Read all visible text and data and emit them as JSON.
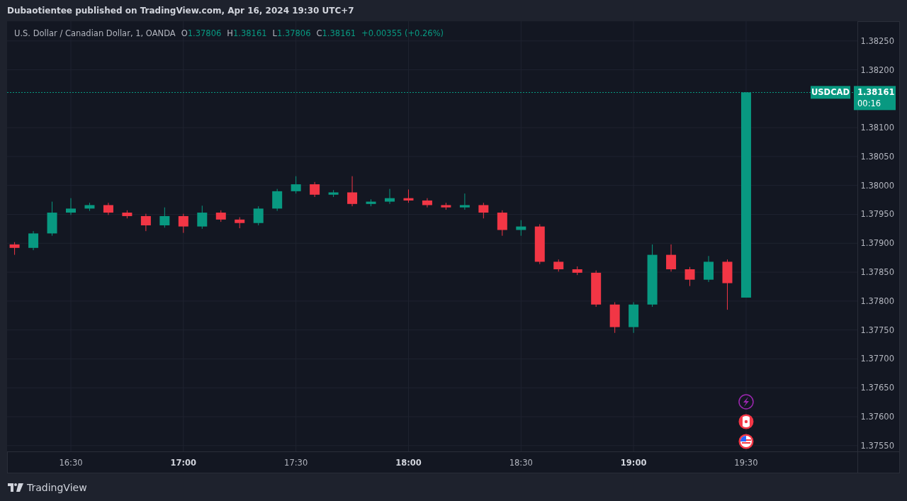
{
  "header": {
    "publisher": "Dubaotientee published on TradingView.com, Apr 16, 2024 19:30 UTC+7"
  },
  "legend": {
    "symbol": "U.S. Dollar / Canadian Dollar, 1, OANDA",
    "ohlc": [
      {
        "label": "O",
        "value": "1.37806"
      },
      {
        "label": "H",
        "value": "1.38161"
      },
      {
        "label": "L",
        "value": "1.37806"
      },
      {
        "label": "C",
        "value": "1.38161"
      }
    ],
    "change": "+0.00355 (+0.26%)"
  },
  "price_label": {
    "ticker": "USDCAD",
    "countdown": "00:16"
  },
  "chart": {
    "chart_data": {
      "type": "candlestick",
      "grid": true,
      "x": [
        975,
        980,
        985,
        990,
        995,
        1000,
        1005,
        1010,
        1015,
        1020,
        1025,
        1030,
        1035,
        1040,
        1045,
        1050,
        1055,
        1060,
        1065,
        1070,
        1075,
        1080,
        1085,
        1090,
        1095,
        1100,
        1105,
        1110,
        1115,
        1120,
        1125,
        1130,
        1135,
        1140,
        1145,
        1150,
        1155,
        1160,
        1165,
        1170
      ],
      "series": [
        {
          "color": "#089981",
          "ohlc": [
            null,
            [
              1.37892,
              1.37921,
              1.37888,
              1.37917
            ],
            [
              1.37917,
              1.37972,
              1.37913,
              1.37953
            ],
            [
              1.37953,
              1.37978,
              1.37949,
              1.3796
            ],
            [
              1.3796,
              1.3797,
              1.37956,
              1.37966
            ],
            null,
            null,
            null,
            [
              1.37931,
              1.37962,
              1.37927,
              1.37947
            ],
            null,
            [
              1.37929,
              1.37965,
              1.37925,
              1.37953
            ],
            null,
            null,
            [
              1.37935,
              1.37964,
              1.37931,
              1.3796
            ],
            [
              1.3796,
              1.37994,
              1.37956,
              1.3799
            ],
            [
              1.3799,
              1.38016,
              1.37986,
              1.38002
            ],
            null,
            [
              1.37984,
              1.37992,
              1.3798,
              1.37988
            ],
            null,
            [
              1.37968,
              1.37976,
              1.37964,
              1.37972
            ],
            [
              1.37972,
              1.37994,
              1.37968,
              1.37978
            ],
            null,
            null,
            null,
            [
              1.37962,
              1.37986,
              1.37958,
              1.37966
            ],
            null,
            null,
            [
              1.37923,
              1.3794,
              1.37913,
              1.37929
            ],
            null,
            null,
            null,
            null,
            null,
            [
              1.37755,
              1.37798,
              1.37745,
              1.37794
            ],
            [
              1.37794,
              1.37898,
              1.3779,
              1.3788
            ],
            null,
            null,
            [
              1.37837,
              1.37878,
              1.37833,
              1.37868
            ],
            null,
            [
              1.37806,
              1.38161,
              1.37806,
              1.38161
            ]
          ]
        },
        {
          "color": "#f23645",
          "ohlc": [
            [
              1.37898,
              1.37902,
              1.3788,
              1.37892
            ],
            null,
            null,
            null,
            null,
            [
              1.37966,
              1.3797,
              1.37949,
              1.37953
            ],
            [
              1.37953,
              1.37957,
              1.37943,
              1.37947
            ],
            [
              1.37947,
              1.37951,
              1.37921,
              1.37931
            ],
            null,
            [
              1.37947,
              1.37951,
              1.37918,
              1.37929
            ],
            null,
            [
              1.37953,
              1.37957,
              1.37937,
              1.37941
            ],
            [
              1.37941,
              1.37945,
              1.37926,
              1.37935
            ],
            null,
            null,
            null,
            [
              1.38002,
              1.38006,
              1.3798,
              1.37984
            ],
            null,
            [
              1.37988,
              1.38016,
              1.37964,
              1.37968
            ],
            null,
            null,
            [
              1.37978,
              1.37993,
              1.3797,
              1.37974
            ],
            [
              1.37974,
              1.37978,
              1.37962,
              1.37966
            ],
            [
              1.37966,
              1.3797,
              1.37958,
              1.37962
            ],
            null,
            [
              1.37966,
              1.3797,
              1.37943,
              1.37953
            ],
            [
              1.37953,
              1.37957,
              1.37913,
              1.37923
            ],
            null,
            [
              1.37929,
              1.37933,
              1.37864,
              1.37868
            ],
            [
              1.37868,
              1.37872,
              1.37851,
              1.37855
            ],
            [
              1.37855,
              1.3786,
              1.37845,
              1.37849
            ],
            [
              1.37849,
              1.37853,
              1.3779,
              1.37794
            ],
            [
              1.37794,
              1.37798,
              1.37745,
              1.37755
            ],
            null,
            null,
            [
              1.3788,
              1.37898,
              1.37851,
              1.37855
            ],
            [
              1.37855,
              1.37859,
              1.37826,
              1.37837
            ],
            null,
            [
              1.37868,
              1.37872,
              1.37785,
              1.37831
            ],
            null
          ]
        }
      ],
      "ref_lines": [
        {
          "axis": "y",
          "value": 1.38161,
          "label": "1.38161",
          "color": "#089981"
        }
      ],
      "xlim": [
        973,
        1211
      ],
      "ylim": [
        1.3754,
        1.38284
      ],
      "xticks": [
        {
          "value": 990,
          "label": "16:30"
        },
        {
          "value": 1020,
          "label": "17:00"
        },
        {
          "value": 1050,
          "label": "17:30"
        },
        {
          "value": 1080,
          "label": "18:00"
        },
        {
          "value": 1110,
          "label": "18:30"
        },
        {
          "value": 1140,
          "label": "19:00"
        },
        {
          "value": 1170,
          "label": "19:30"
        }
      ],
      "yticks": [
        {
          "value": 1.3825,
          "label": "1.38250"
        },
        {
          "value": 1.382,
          "label": "1.38200"
        },
        {
          "value": 1.381,
          "label": "1.38100"
        },
        {
          "value": 1.3805,
          "label": "1.38050"
        },
        {
          "value": 1.38,
          "label": "1.38000"
        },
        {
          "value": 1.3795,
          "label": "1.37950"
        },
        {
          "value": 1.379,
          "label": "1.37900"
        },
        {
          "value": 1.3785,
          "label": "1.37850"
        },
        {
          "value": 1.378,
          "label": "1.37800"
        },
        {
          "value": 1.3775,
          "label": "1.37750"
        },
        {
          "value": 1.377,
          "label": "1.37700"
        },
        {
          "value": 1.3765,
          "label": "1.37650"
        },
        {
          "value": 1.376,
          "label": "1.37600"
        },
        {
          "value": 1.3755,
          "label": "1.37550"
        }
      ]
    }
  },
  "footer": {
    "brand": "TradingView"
  }
}
